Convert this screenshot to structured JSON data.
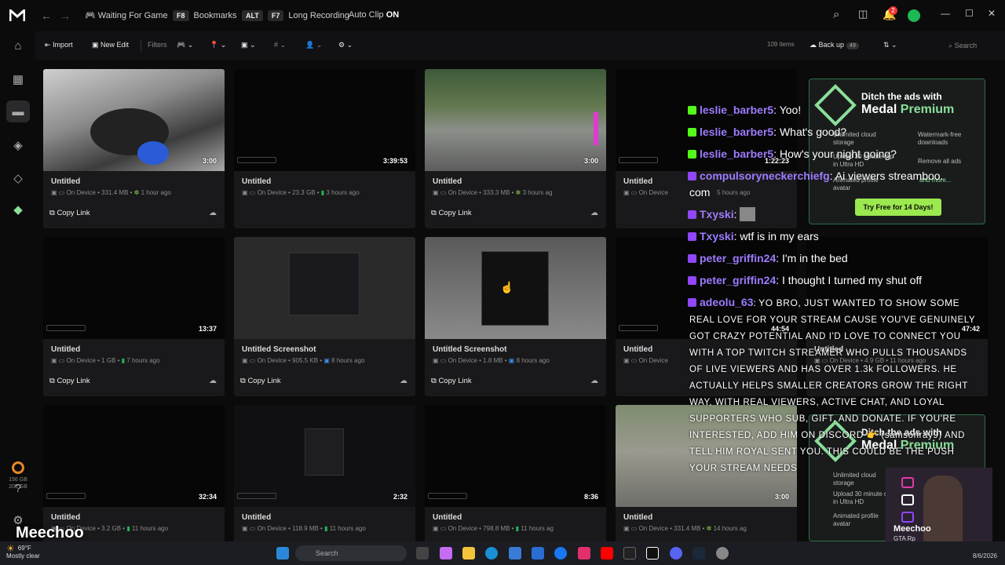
{
  "titlebar": {
    "game_status": "Waiting For Game",
    "bookmarks_key": "F8",
    "bookmarks_label": "Bookmarks",
    "long_recording_key1": "ALT",
    "long_recording_key2": "F7",
    "long_recording_label": "Long Recording",
    "autoclip_label": "Auto Clip",
    "autoclip_state": "ON",
    "notification_count": "2"
  },
  "sidebar": {
    "storage_used": "156 GB",
    "storage_total": "200 GB"
  },
  "toolbar": {
    "import_label": "Import",
    "new_edit_label": "New Edit",
    "filters_label": "Filters",
    "items_count": "109 items",
    "backup_label": "Back up",
    "backup_count": "49",
    "search_placeholder": "Search"
  },
  "cards": [
    {
      "title": "Untitled",
      "location": "On Device",
      "size": "331.4 MB",
      "age": "1 hour ago",
      "duration": "3:00",
      "copy": "Copy Link"
    },
    {
      "title": "Untitled",
      "location": "On Device",
      "size": "23.3 GB",
      "age": "3 hours ago",
      "duration": "3:39:53",
      "copy": ""
    },
    {
      "title": "Untitled",
      "location": "On Device",
      "size": "333.3 MB",
      "age": "3 hours ag",
      "duration": "3:00",
      "copy": "Copy Link"
    },
    {
      "title": "Untitled",
      "location": "On Device",
      "size": "",
      "age": "5 hours ago",
      "duration": "1:22:23",
      "copy": ""
    },
    {
      "title": "Untitled",
      "location": "On Device",
      "size": "1 GB",
      "age": "7 hours ago",
      "duration": "13:37",
      "copy": "Copy Link"
    },
    {
      "title": "Untitled Screenshot",
      "location": "On Device",
      "size": "905.5 KB",
      "age": "8 hours ago",
      "duration": "",
      "copy": "Copy Link"
    },
    {
      "title": "Untitled Screenshot",
      "location": "On Device",
      "size": "1.8 MB",
      "age": "8 hours ago",
      "duration": "",
      "copy": "Copy Link"
    },
    {
      "title": "Untitled",
      "location": "On Device",
      "size": "",
      "age": "",
      "duration": "44:54",
      "copy": ""
    },
    {
      "title": "Untitled",
      "location": "On Device",
      "size": "4.9 GB",
      "age": "11 hours ago",
      "duration": "47:42",
      "copy": ""
    },
    {
      "title": "Untitled",
      "location": "On Device",
      "size": "3.2 GB",
      "age": "11 hours ago",
      "duration": "32:34",
      "copy": ""
    },
    {
      "title": "Untitled",
      "location": "On Device",
      "size": "118.9 MB",
      "age": "11 hours ago",
      "duration": "2:32",
      "copy": ""
    },
    {
      "title": "Untitled",
      "location": "On Device",
      "size": "798.8 MB",
      "age": "11 hours ag",
      "duration": "8:36",
      "copy": ""
    },
    {
      "title": "Untitled",
      "location": "On Device",
      "size": "331.4 MB",
      "age": "14 hours ag",
      "duration": "3:00",
      "copy": ""
    }
  ],
  "ad": {
    "line1": "Ditch the ads with",
    "brand": "Medal",
    "premium": "Premium",
    "feat1": "Unlimited cloud storage",
    "feat2": "Watermark-free downloads",
    "feat3": "Upload 30 minute clip in Ultra HD",
    "feat4": "Remove all ads",
    "feat5": "Animated profile avatar",
    "feat6": "and more...",
    "cta": "Try Free for 14 Days!"
  },
  "chat": [
    {
      "platform": "kick",
      "user": "leslie_barber5",
      "msg": "Yoo!"
    },
    {
      "platform": "kick",
      "user": "leslie_barber5",
      "msg": "What's good?"
    },
    {
      "platform": "kick",
      "user": "leslie_barber5",
      "msg": "How's your night going?"
    },
    {
      "platform": "twitch",
      "user": "compulsoryneckerchiefg",
      "msg": "Ai viewers streamboo."
    },
    {
      "platform": "",
      "user": "",
      "msg": "com"
    },
    {
      "platform": "twitch",
      "user": "Txyski",
      "msg": ""
    },
    {
      "platform": "twitch",
      "user": "Txyski",
      "msg": "wtf is in my ears"
    },
    {
      "platform": "twitch",
      "user": "peter_griffin24",
      "msg": "I'm in the bed"
    },
    {
      "platform": "twitch",
      "user": "peter_griffin24",
      "msg": "I thought I turned my shut off"
    },
    {
      "platform": "twitch",
      "user": "adeolu_63",
      "msg": "YO BRO, JUST WANTED TO SHOW SOME"
    }
  ],
  "chat_long": "REAL LOVE FOR YOUR STREAM CAUSE YOU'VE GENUINELY GOT CRAZY POTENTIAL AND I'D LOVE TO CONNECT YOU WITH A TOP TWITCH STREAMER WHO PULLS THOUSANDS OF LIVE VIEWERS AND HAS OVER 1.3k FOLLOWERS. HE ACTUALLY HELPS SMALLER CREATORS GROW THE RIGHT WAY, WITH REAL VIEWERS, ACTIVE CHAT, AND LOYAL SUPPORTERS WHO SUB, GIFT, AND DONATE. IF YOU'RE INTERESTED, ADD HIM ON DISCORD 👉 (samsonray9) AND TELL HIM ROYAL SENT YOU. THIS COULD BE THE PUSH YOUR STREAM NEEDS",
  "webcam": {
    "name": "Meechoo",
    "sub": "GTA Rp"
  },
  "watermark": "Meechoo",
  "taskbar": {
    "temp": "69°F",
    "weather": "Mostly clear",
    "search": "Search",
    "date": "8/6/2026"
  }
}
